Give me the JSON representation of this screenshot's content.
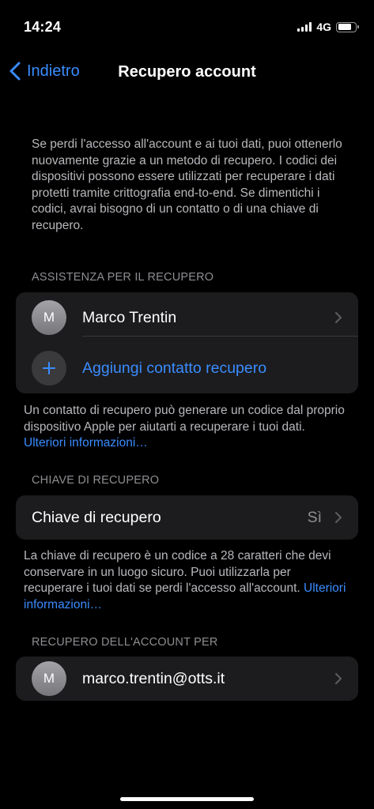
{
  "status_bar": {
    "time": "14:24",
    "network": "4G",
    "battery_level": 0.8
  },
  "nav": {
    "back_label": "Indietro",
    "title": "Recupero account"
  },
  "intro_text": "Se perdi l'accesso all'account e ai tuoi dati, puoi ottenerlo nuovamente grazie a un metodo di recupero. I codici dei dispositivi possono essere utilizzati per recuperare i dati protetti tramite crittografia end-to-end. Se dimentichi i codici, avrai bisogno di un contatto o di una chiave di recupero.",
  "assistance": {
    "header": "ASSISTENZA PER IL RECUPERO",
    "contact": {
      "initial": "M",
      "name": "Marco Trentin"
    },
    "add_label": "Aggiungi contatto recupero",
    "footnote": "Un contatto di recupero può generare un codice dal proprio dispositivo Apple per aiutarti a recuperare i tuoi dati.",
    "link": "Ulteriori informazioni…"
  },
  "recovery_key": {
    "header": "CHIAVE DI RECUPERO",
    "label": "Chiave di recupero",
    "value": "Sì",
    "footnote": "La chiave di recupero è un codice a 28 caratteri che devi conservare in un luogo sicuro. Puoi utilizzarla per recuperare i tuoi dati se perdi l'accesso all'account.",
    "link": "Ulteriori informazioni…"
  },
  "account_recovery_for": {
    "header": "RECUPERO DELL'ACCOUNT PER",
    "initial": "M",
    "email": "marco.trentin@otts.it"
  },
  "colors": {
    "accent": "#3a8cff",
    "background": "#000000",
    "cell": "#1c1c1e",
    "secondary_text": "#8e8e93"
  }
}
